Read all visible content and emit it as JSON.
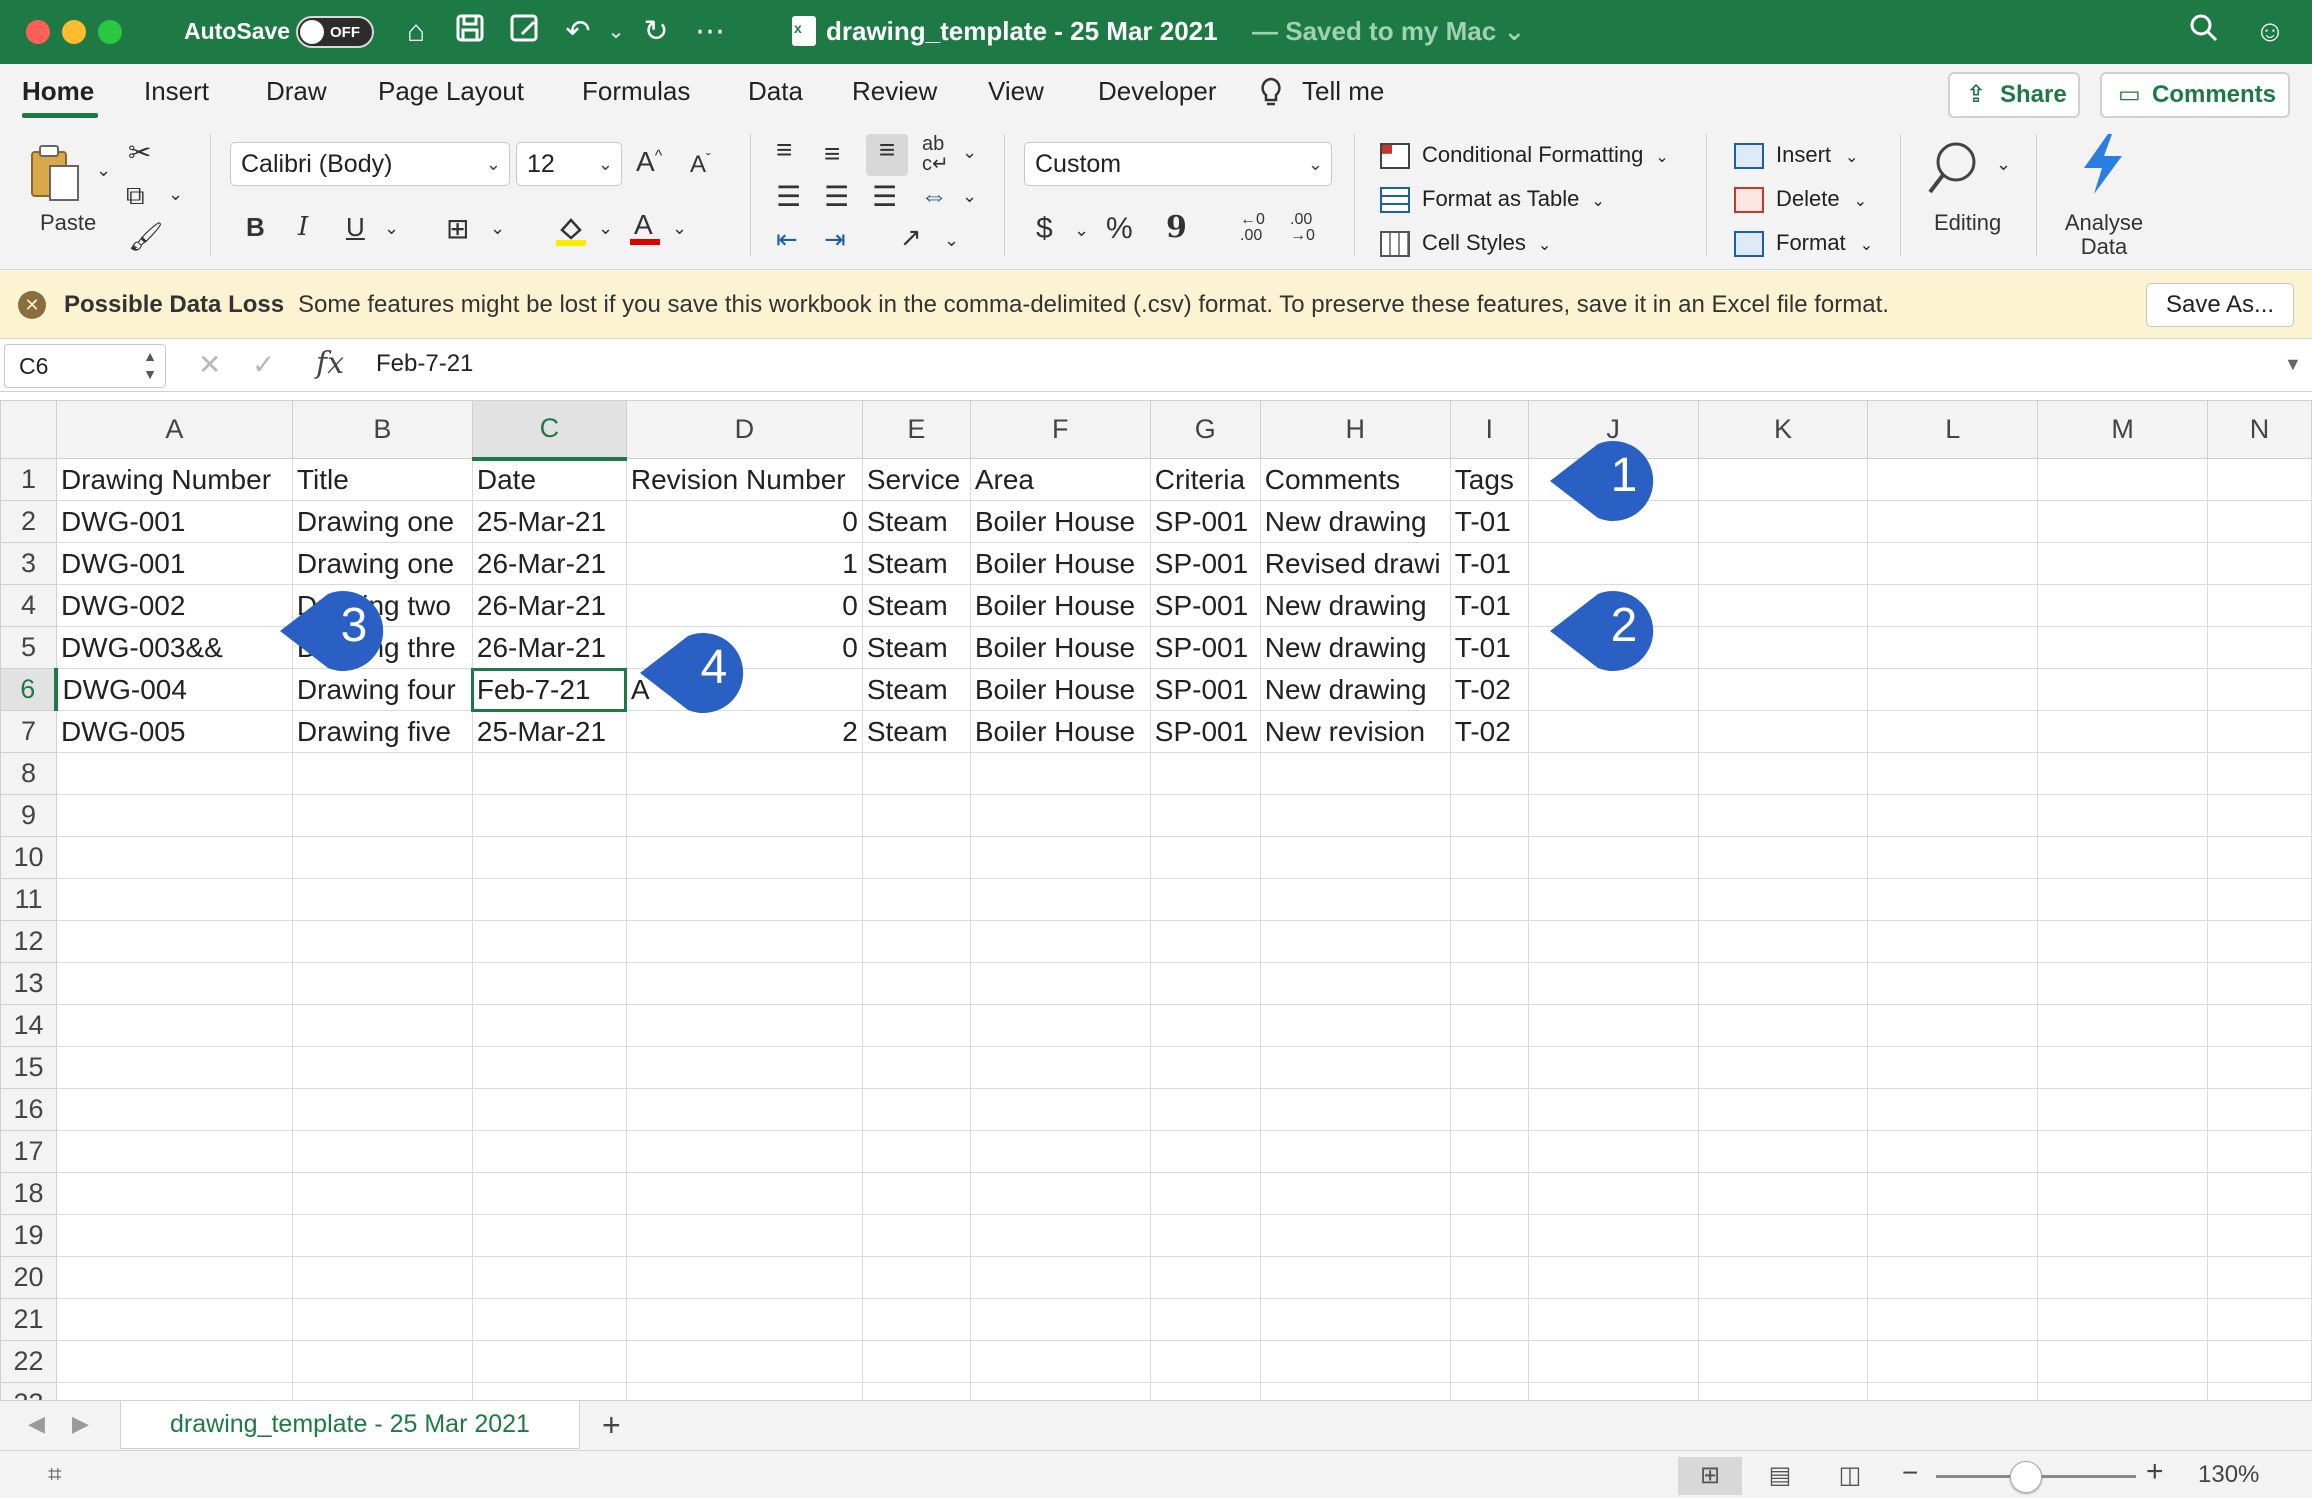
{
  "titlebar": {
    "autosave_label": "AutoSave",
    "autosave_state": "OFF",
    "doc_title": "drawing_template - 25 Mar 2021",
    "doc_status": "— Saved to my Mac ⌄"
  },
  "tabs": [
    "Home",
    "Insert",
    "Draw",
    "Page Layout",
    "Formulas",
    "Data",
    "Review",
    "View",
    "Developer",
    "Tell me"
  ],
  "top_buttons": {
    "share": "Share",
    "comments": "Comments"
  },
  "ribbon": {
    "paste": "Paste",
    "font_name": "Calibri (Body)",
    "font_size": "12",
    "bold": "B",
    "italic": "I",
    "underline": "U",
    "number_format": "Custom",
    "currency": "$",
    "percent": "%",
    "comma": "9",
    "conditional_formatting": "Conditional Formatting",
    "format_as_table": "Format as Table",
    "cell_styles": "Cell Styles",
    "insert": "Insert",
    "delete": "Delete",
    "format": "Format",
    "editing": "Editing",
    "analyse_data_line1": "Analyse",
    "analyse_data_line2": "Data"
  },
  "message_bar": {
    "title": "Possible Data Loss",
    "text": "Some features might be lost if you save this workbook in the comma-delimited (.csv) format. To preserve these features, save it in an Excel file format.",
    "button": "Save As..."
  },
  "formula_bar": {
    "name_box": "C6",
    "fx": "fx",
    "formula": "Feb-7-21"
  },
  "grid": {
    "columns": [
      "A",
      "B",
      "C",
      "D",
      "E",
      "F",
      "G",
      "H",
      "I",
      "J",
      "K",
      "L",
      "M",
      "N"
    ],
    "selected_column": "C",
    "selected_row": 6,
    "rows": [
      [
        "Drawing Number",
        "Title",
        "Date",
        "Revision Number",
        "Service",
        "Area",
        "Criteria",
        "Comments",
        "Tags"
      ],
      [
        "DWG-001",
        "Drawing one",
        "25-Mar-21",
        "0",
        "Steam",
        "Boiler House",
        "SP-001",
        "New drawing",
        "T-01"
      ],
      [
        "DWG-001",
        "Drawing one",
        "26-Mar-21",
        "1",
        "Steam",
        "Boiler House",
        "SP-001",
        "Revised drawi",
        "T-01"
      ],
      [
        "DWG-002",
        "Drawing two",
        "26-Mar-21",
        "0",
        "Steam",
        "Boiler House",
        "SP-001",
        "New drawing",
        "T-01"
      ],
      [
        "DWG-003&&",
        "Drawing thre",
        "26-Mar-21",
        "0",
        "Steam",
        "Boiler House",
        "SP-001",
        "New drawing",
        "T-01"
      ],
      [
        "DWG-004",
        "Drawing four",
        "Feb-7-21",
        "A",
        "Steam",
        "Boiler House",
        "SP-001",
        "New drawing",
        "T-02"
      ],
      [
        "DWG-005",
        "Drawing five",
        "25-Mar-21",
        "2",
        "Steam",
        "Boiler House",
        "SP-001",
        "New revision",
        "T-02"
      ]
    ],
    "row_count": 23
  },
  "callouts": [
    "1",
    "2",
    "3",
    "4"
  ],
  "sheet_tab": "drawing_template - 25 Mar 2021",
  "status_bar": {
    "zoom": "130%",
    "zoom_fraction": 0.45
  }
}
